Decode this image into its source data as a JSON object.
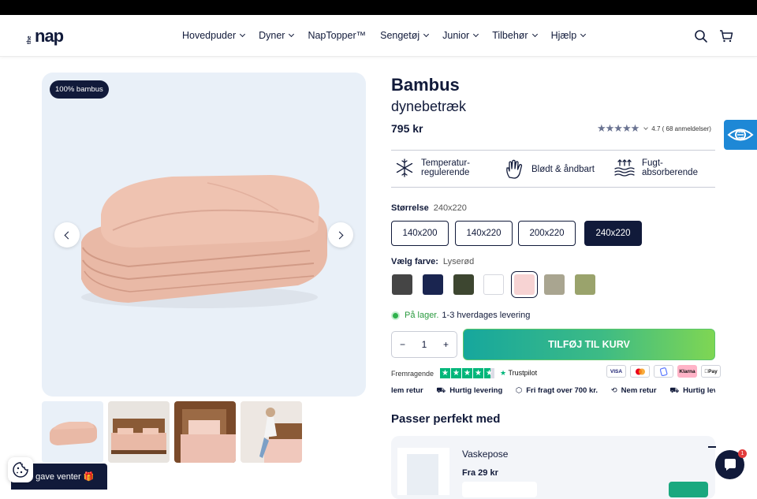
{
  "header": {
    "logo_small": "the",
    "logo_main": "nap",
    "nav": [
      {
        "label": "Hovedpuder",
        "dropdown": true
      },
      {
        "label": "Dyner",
        "dropdown": true
      },
      {
        "label": "NapTopper™",
        "dropdown": false
      },
      {
        "label": "Sengetøj",
        "dropdown": true
      },
      {
        "label": "Junior",
        "dropdown": true
      },
      {
        "label": "Tilbehør",
        "dropdown": true
      },
      {
        "label": "Hjælp",
        "dropdown": true
      }
    ]
  },
  "gallery": {
    "badge": "100% bambus",
    "thumbnail_count": 4
  },
  "product": {
    "title": "Bambus",
    "subtitle": "dynebetræk",
    "price": "795 kr",
    "rating_value": "4.7",
    "rating_text": "4.7 ( 68 anmeldelser)",
    "rating_stars": 4.7
  },
  "features": [
    {
      "icon": "snowflake-sun-icon",
      "label": "Temperatur-\nregulerende"
    },
    {
      "icon": "hand-icon",
      "label": "Blødt & åndbart"
    },
    {
      "icon": "moisture-icon",
      "label": "Fugt-\nabsorberende"
    }
  ],
  "size": {
    "label": "Størrelse",
    "selected": "240x220",
    "options": [
      "140x200",
      "140x220",
      "200x220",
      "240x220"
    ]
  },
  "color": {
    "label": "Vælg farve:",
    "selected": "Lyserød",
    "swatches": [
      "#454545",
      "#1a2550",
      "#3d4630",
      "#ffffff",
      "#f7d3d3",
      "#a9a590",
      "#9aa36c"
    ],
    "selected_index": 4
  },
  "stock": {
    "status": "På lager.",
    "delivery": "1-3 hverdages levering"
  },
  "quantity": {
    "minus": "−",
    "value": "1",
    "plus": "+"
  },
  "add_to_cart": "TILFØJ TIL KURV",
  "trustpilot": {
    "label": "Fremragende",
    "brand": "Trustpilot"
  },
  "payments": [
    "VISA",
    "MC",
    "MobilePay",
    "Klarna",
    "Apple Pay"
  ],
  "ticker": [
    {
      "icon": "box-icon",
      "text": "Nem retur",
      "partial": "lem retur"
    },
    {
      "icon": "truck-icon",
      "text": "Hurtig levering"
    },
    {
      "icon": "package-icon",
      "text": "Fri fragt over 700 kr."
    },
    {
      "icon": "return-icon",
      "text": "Nem retur"
    },
    {
      "icon": "truck-icon",
      "text": "Hurtig leve"
    }
  ],
  "upsell": {
    "heading": "Passer perfekt med",
    "name": "Vaskepose",
    "price": "Fra 29 kr"
  },
  "gift_banner": "n gave venter 🎁",
  "chat_badge": "1",
  "colors": {
    "navy": "#111a3a",
    "accent_green": "#2fb24c",
    "gallery_bg": "#e9f0f8",
    "a11y_blue": "#1e88d6"
  }
}
